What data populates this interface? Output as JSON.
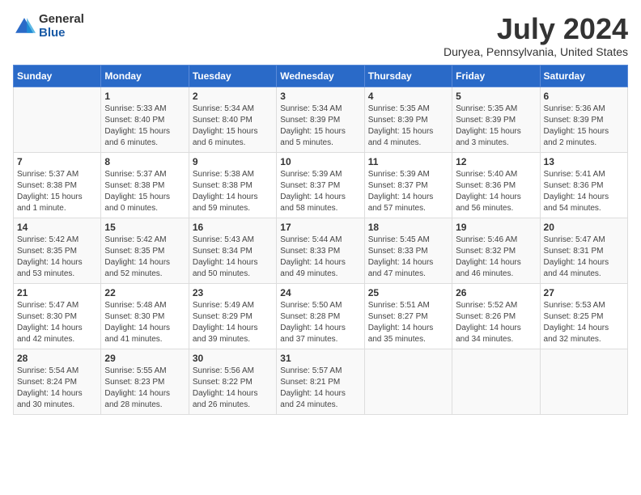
{
  "logo": {
    "general": "General",
    "blue": "Blue"
  },
  "header": {
    "title": "July 2024",
    "location": "Duryea, Pennsylvania, United States"
  },
  "days_of_week": [
    "Sunday",
    "Monday",
    "Tuesday",
    "Wednesday",
    "Thursday",
    "Friday",
    "Saturday"
  ],
  "weeks": [
    [
      {
        "day": "",
        "sunrise": "",
        "sunset": "",
        "daylight": ""
      },
      {
        "day": "1",
        "sunrise": "Sunrise: 5:33 AM",
        "sunset": "Sunset: 8:40 PM",
        "daylight": "Daylight: 15 hours and 6 minutes."
      },
      {
        "day": "2",
        "sunrise": "Sunrise: 5:34 AM",
        "sunset": "Sunset: 8:40 PM",
        "daylight": "Daylight: 15 hours and 6 minutes."
      },
      {
        "day": "3",
        "sunrise": "Sunrise: 5:34 AM",
        "sunset": "Sunset: 8:39 PM",
        "daylight": "Daylight: 15 hours and 5 minutes."
      },
      {
        "day": "4",
        "sunrise": "Sunrise: 5:35 AM",
        "sunset": "Sunset: 8:39 PM",
        "daylight": "Daylight: 15 hours and 4 minutes."
      },
      {
        "day": "5",
        "sunrise": "Sunrise: 5:35 AM",
        "sunset": "Sunset: 8:39 PM",
        "daylight": "Daylight: 15 hours and 3 minutes."
      },
      {
        "day": "6",
        "sunrise": "Sunrise: 5:36 AM",
        "sunset": "Sunset: 8:39 PM",
        "daylight": "Daylight: 15 hours and 2 minutes."
      }
    ],
    [
      {
        "day": "7",
        "sunrise": "Sunrise: 5:37 AM",
        "sunset": "Sunset: 8:38 PM",
        "daylight": "Daylight: 15 hours and 1 minute."
      },
      {
        "day": "8",
        "sunrise": "Sunrise: 5:37 AM",
        "sunset": "Sunset: 8:38 PM",
        "daylight": "Daylight: 15 hours and 0 minutes."
      },
      {
        "day": "9",
        "sunrise": "Sunrise: 5:38 AM",
        "sunset": "Sunset: 8:38 PM",
        "daylight": "Daylight: 14 hours and 59 minutes."
      },
      {
        "day": "10",
        "sunrise": "Sunrise: 5:39 AM",
        "sunset": "Sunset: 8:37 PM",
        "daylight": "Daylight: 14 hours and 58 minutes."
      },
      {
        "day": "11",
        "sunrise": "Sunrise: 5:39 AM",
        "sunset": "Sunset: 8:37 PM",
        "daylight": "Daylight: 14 hours and 57 minutes."
      },
      {
        "day": "12",
        "sunrise": "Sunrise: 5:40 AM",
        "sunset": "Sunset: 8:36 PM",
        "daylight": "Daylight: 14 hours and 56 minutes."
      },
      {
        "day": "13",
        "sunrise": "Sunrise: 5:41 AM",
        "sunset": "Sunset: 8:36 PM",
        "daylight": "Daylight: 14 hours and 54 minutes."
      }
    ],
    [
      {
        "day": "14",
        "sunrise": "Sunrise: 5:42 AM",
        "sunset": "Sunset: 8:35 PM",
        "daylight": "Daylight: 14 hours and 53 minutes."
      },
      {
        "day": "15",
        "sunrise": "Sunrise: 5:42 AM",
        "sunset": "Sunset: 8:35 PM",
        "daylight": "Daylight: 14 hours and 52 minutes."
      },
      {
        "day": "16",
        "sunrise": "Sunrise: 5:43 AM",
        "sunset": "Sunset: 8:34 PM",
        "daylight": "Daylight: 14 hours and 50 minutes."
      },
      {
        "day": "17",
        "sunrise": "Sunrise: 5:44 AM",
        "sunset": "Sunset: 8:33 PM",
        "daylight": "Daylight: 14 hours and 49 minutes."
      },
      {
        "day": "18",
        "sunrise": "Sunrise: 5:45 AM",
        "sunset": "Sunset: 8:33 PM",
        "daylight": "Daylight: 14 hours and 47 minutes."
      },
      {
        "day": "19",
        "sunrise": "Sunrise: 5:46 AM",
        "sunset": "Sunset: 8:32 PM",
        "daylight": "Daylight: 14 hours and 46 minutes."
      },
      {
        "day": "20",
        "sunrise": "Sunrise: 5:47 AM",
        "sunset": "Sunset: 8:31 PM",
        "daylight": "Daylight: 14 hours and 44 minutes."
      }
    ],
    [
      {
        "day": "21",
        "sunrise": "Sunrise: 5:47 AM",
        "sunset": "Sunset: 8:30 PM",
        "daylight": "Daylight: 14 hours and 42 minutes."
      },
      {
        "day": "22",
        "sunrise": "Sunrise: 5:48 AM",
        "sunset": "Sunset: 8:30 PM",
        "daylight": "Daylight: 14 hours and 41 minutes."
      },
      {
        "day": "23",
        "sunrise": "Sunrise: 5:49 AM",
        "sunset": "Sunset: 8:29 PM",
        "daylight": "Daylight: 14 hours and 39 minutes."
      },
      {
        "day": "24",
        "sunrise": "Sunrise: 5:50 AM",
        "sunset": "Sunset: 8:28 PM",
        "daylight": "Daylight: 14 hours and 37 minutes."
      },
      {
        "day": "25",
        "sunrise": "Sunrise: 5:51 AM",
        "sunset": "Sunset: 8:27 PM",
        "daylight": "Daylight: 14 hours and 35 minutes."
      },
      {
        "day": "26",
        "sunrise": "Sunrise: 5:52 AM",
        "sunset": "Sunset: 8:26 PM",
        "daylight": "Daylight: 14 hours and 34 minutes."
      },
      {
        "day": "27",
        "sunrise": "Sunrise: 5:53 AM",
        "sunset": "Sunset: 8:25 PM",
        "daylight": "Daylight: 14 hours and 32 minutes."
      }
    ],
    [
      {
        "day": "28",
        "sunrise": "Sunrise: 5:54 AM",
        "sunset": "Sunset: 8:24 PM",
        "daylight": "Daylight: 14 hours and 30 minutes."
      },
      {
        "day": "29",
        "sunrise": "Sunrise: 5:55 AM",
        "sunset": "Sunset: 8:23 PM",
        "daylight": "Daylight: 14 hours and 28 minutes."
      },
      {
        "day": "30",
        "sunrise": "Sunrise: 5:56 AM",
        "sunset": "Sunset: 8:22 PM",
        "daylight": "Daylight: 14 hours and 26 minutes."
      },
      {
        "day": "31",
        "sunrise": "Sunrise: 5:57 AM",
        "sunset": "Sunset: 8:21 PM",
        "daylight": "Daylight: 14 hours and 24 minutes."
      },
      {
        "day": "",
        "sunrise": "",
        "sunset": "",
        "daylight": ""
      },
      {
        "day": "",
        "sunrise": "",
        "sunset": "",
        "daylight": ""
      },
      {
        "day": "",
        "sunrise": "",
        "sunset": "",
        "daylight": ""
      }
    ]
  ]
}
